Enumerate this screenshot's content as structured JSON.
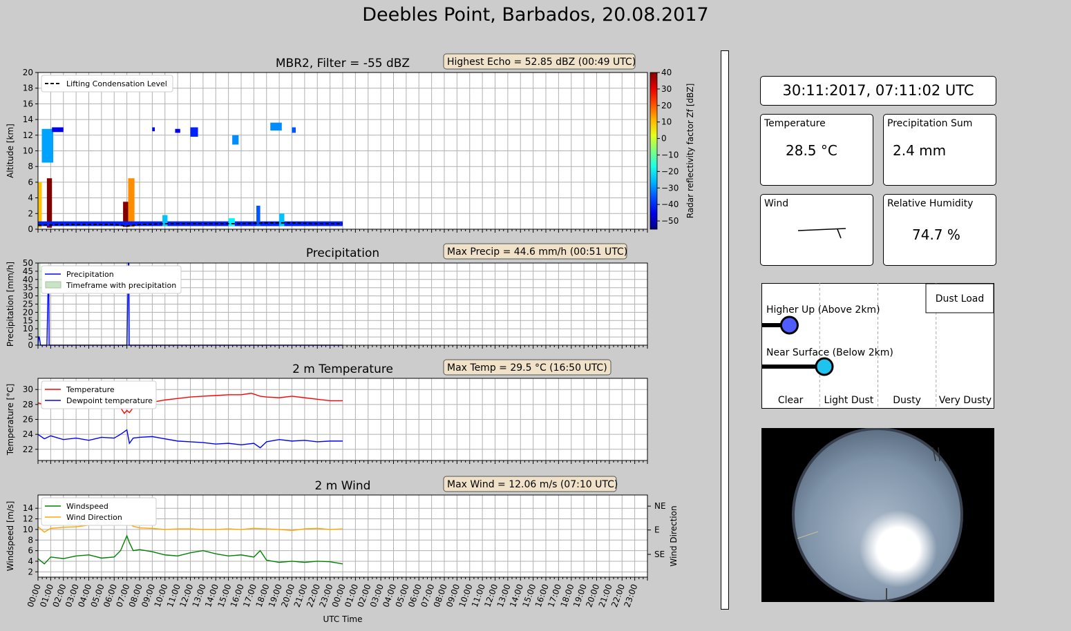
{
  "page": {
    "title": "Deebles Point, Barbados, 20.08.2017"
  },
  "colors": {
    "background": "#cccccc",
    "grid": "#b0b0b0",
    "precip_line": "#0000ff",
    "precip_band": "#c8e3c8",
    "temp_line": "#ff0000",
    "dewpoint_line": "#0000ff",
    "windspeed_line": "#008000",
    "winddir_line": "#ffa500",
    "lcl_line": "#000000",
    "dust_upper": "#4f5cff",
    "dust_lower": "#1ec3f0",
    "annotation_bg": "#f0e2c8"
  },
  "time_axis": {
    "label": "UTC Time",
    "ticks": [
      "00:00",
      "01:00",
      "02:00",
      "03:00",
      "04:00",
      "05:00",
      "06:00",
      "07:00",
      "08:00",
      "09:00",
      "10:00",
      "11:00",
      "12:00",
      "13:00",
      "14:00",
      "15:00",
      "16:00",
      "17:00",
      "18:00",
      "19:00",
      "20:00",
      "21:00",
      "22:00",
      "23:00",
      "00:00",
      "01:00",
      "02:00",
      "03:00",
      "04:00",
      "05:00",
      "06:00",
      "07:00",
      "08:00",
      "09:00",
      "10:00",
      "11:00",
      "12:00",
      "13:00",
      "14:00",
      "15:00",
      "16:00",
      "17:00",
      "18:00",
      "19:00",
      "20:00",
      "21:00",
      "22:00",
      "23:00"
    ],
    "range_hours": [
      0,
      48
    ],
    "data_until_hours": 24
  },
  "chart_data": [
    {
      "type": "heatmap",
      "title": "MBR2, Filter = -55 dBZ",
      "annotation": "Highest Echo = 52.85 dBZ (00:49 UTC)",
      "ylabel": "Altitude [km]",
      "ylim": [
        0,
        20
      ],
      "yticks": [
        0,
        2,
        4,
        6,
        8,
        10,
        12,
        14,
        16,
        18,
        20
      ],
      "grid": true,
      "legend": {
        "position": "top-left",
        "entries": [
          "Lifting Condensation Level"
        ]
      },
      "colorbar": {
        "label": "Radar reflectivity factor Zf [dBZ]",
        "range": [
          -55,
          40
        ],
        "ticks": [
          40,
          30,
          20,
          10,
          0,
          -10,
          -20,
          -30,
          -40,
          -50
        ],
        "tick_labels": [
          "40",
          "30",
          "20",
          "10",
          "0",
          "−10",
          "−20",
          "−30",
          "−40",
          "−50"
        ]
      },
      "lcl_km": {
        "x": [
          0,
          2,
          4,
          6,
          7,
          8,
          10,
          12,
          14,
          16,
          18,
          20,
          22,
          24
        ],
        "y": [
          0.5,
          0.6,
          0.6,
          0.6,
          0.4,
          0.6,
          0.7,
          0.7,
          0.7,
          0.7,
          0.8,
          0.8,
          0.7,
          0.7
        ]
      },
      "echoes": [
        {
          "x0": 0.0,
          "x1": 0.3,
          "y0": 0.2,
          "y1": 6.0,
          "dbz": 10
        },
        {
          "x0": 0.3,
          "x1": 1.2,
          "y0": 8.5,
          "y1": 12.8,
          "dbz": -28
        },
        {
          "x0": 0.7,
          "x1": 1.1,
          "y0": 0.2,
          "y1": 6.5,
          "dbz": 40
        },
        {
          "x0": 1.1,
          "x1": 2.0,
          "y0": 12.4,
          "y1": 13.0,
          "dbz": -45
        },
        {
          "x0": 6.7,
          "x1": 7.2,
          "y0": 0.3,
          "y1": 3.5,
          "dbz": 40
        },
        {
          "x0": 7.1,
          "x1": 7.6,
          "y0": 0.3,
          "y1": 6.5,
          "dbz": 15
        },
        {
          "x0": 9.0,
          "x1": 9.2,
          "y0": 12.5,
          "y1": 13.0,
          "dbz": -45
        },
        {
          "x0": 10.8,
          "x1": 11.2,
          "y0": 12.3,
          "y1": 12.8,
          "dbz": -45
        },
        {
          "x0": 12.0,
          "x1": 12.6,
          "y0": 11.8,
          "y1": 13.0,
          "dbz": -40
        },
        {
          "x0": 15.3,
          "x1": 15.8,
          "y0": 10.8,
          "y1": 12.0,
          "dbz": -30
        },
        {
          "x0": 18.3,
          "x1": 19.2,
          "y0": 12.6,
          "y1": 13.6,
          "dbz": -30
        },
        {
          "x0": 20.0,
          "x1": 20.3,
          "y0": 12.3,
          "y1": 13.0,
          "dbz": -35
        },
        {
          "x0": 0.0,
          "x1": 24.0,
          "y0": 0.4,
          "y1": 1.0,
          "dbz": -40
        },
        {
          "x0": 9.8,
          "x1": 10.2,
          "y0": 0.4,
          "y1": 1.8,
          "dbz": -25
        },
        {
          "x0": 15.0,
          "x1": 15.5,
          "y0": 0.4,
          "y1": 1.4,
          "dbz": -20
        },
        {
          "x0": 17.2,
          "x1": 17.5,
          "y0": 0.4,
          "y1": 3.0,
          "dbz": -35
        },
        {
          "x0": 19.0,
          "x1": 19.4,
          "y0": 0.4,
          "y1": 2.0,
          "dbz": -25
        }
      ]
    },
    {
      "type": "line",
      "title": "Precipitation",
      "annotation": "Max Precip = 44.6 mm/h (00:51 UTC)",
      "ylabel": "Precipitation [mm/h]",
      "ylim": [
        0,
        50
      ],
      "yticks": [
        0,
        5,
        10,
        15,
        20,
        25,
        30,
        35,
        40,
        45,
        50
      ],
      "grid": true,
      "legend": {
        "position": "top-left",
        "entries": [
          "Precipitation",
          "Timeframe with precipitation"
        ]
      },
      "series": [
        {
          "name": "Precipitation",
          "x": [
            0,
            0.05,
            0.1,
            0.2,
            0.7,
            0.82,
            0.85,
            0.88,
            1.0,
            7.0,
            7.12,
            7.15,
            7.18,
            7.3,
            24
          ],
          "y": [
            0,
            5,
            5,
            0,
            0,
            44.6,
            44.6,
            0,
            0,
            0,
            50,
            50,
            0,
            0,
            0
          ]
        }
      ],
      "precip_windows": [
        [
          0.0,
          0.2
        ],
        [
          0.8,
          0.9
        ],
        [
          7.05,
          7.25
        ]
      ]
    },
    {
      "type": "line",
      "title": "2 m Temperature",
      "annotation": "Max Temp = 29.5 °C (16:50 UTC)",
      "ylabel": "Temperature [°C]",
      "ylim": [
        20.5,
        31.5
      ],
      "yticks": [
        22,
        24,
        26,
        28,
        30
      ],
      "grid": true,
      "legend": {
        "position": "top-left",
        "entries": [
          "Temperature",
          "Dewpoint temperature"
        ]
      },
      "series": [
        {
          "name": "Temperature",
          "x": [
            0,
            0.5,
            1,
            2,
            3,
            4,
            5,
            6,
            6.5,
            6.8,
            7.0,
            7.2,
            7.5,
            8,
            9,
            10,
            11,
            12,
            13,
            14,
            15,
            16,
            16.8,
            17.5,
            18,
            19,
            20,
            21,
            22,
            23,
            24
          ],
          "y": [
            28.2,
            28.0,
            28.3,
            28.1,
            28.4,
            28.2,
            28.4,
            28.1,
            27.6,
            26.8,
            27.2,
            26.9,
            27.6,
            28.1,
            28.3,
            28.6,
            28.8,
            29.0,
            29.1,
            29.2,
            29.3,
            29.3,
            29.5,
            29.1,
            29.0,
            28.9,
            29.1,
            28.9,
            28.7,
            28.5,
            28.5
          ]
        },
        {
          "name": "Dewpoint temperature",
          "x": [
            0,
            0.5,
            1,
            2,
            3,
            4,
            5,
            6,
            6.5,
            7.0,
            7.2,
            7.5,
            8,
            9,
            10,
            11,
            12,
            13,
            14,
            15,
            16,
            17,
            17.5,
            18,
            19,
            20,
            21,
            22,
            23,
            24
          ],
          "y": [
            24.0,
            23.4,
            23.8,
            23.3,
            23.5,
            23.2,
            23.6,
            23.5,
            24.0,
            24.6,
            22.8,
            23.5,
            23.6,
            23.7,
            23.4,
            23.1,
            23.0,
            22.9,
            22.7,
            22.8,
            22.6,
            22.8,
            22.2,
            23.0,
            23.3,
            23.1,
            23.2,
            23.0,
            23.1,
            23.1
          ]
        }
      ]
    },
    {
      "type": "line",
      "title": "2 m Wind",
      "annotation": "Max Wind = 12.06 m/s (07:10 UTC)",
      "ylabel": "Windspeed [m/s]",
      "ylim": [
        1,
        16.5
      ],
      "yticks": [
        2,
        4,
        6,
        8,
        10,
        12,
        14
      ],
      "y2label": "Wind Direction",
      "y2ticks": [
        {
          "label": "NE",
          "value": 14.4
        },
        {
          "label": "E",
          "value": 9.9
        },
        {
          "label": "SE",
          "value": 5.3
        }
      ],
      "grid": true,
      "legend": {
        "position": "top-left",
        "entries": [
          "Windspeed",
          "Wind Direction"
        ]
      },
      "series": [
        {
          "name": "Windspeed",
          "x": [
            0,
            0.5,
            1,
            2,
            3,
            4,
            5,
            6,
            6.5,
            7.0,
            7.2,
            7.5,
            8,
            9,
            10,
            11,
            12,
            13,
            14,
            15,
            16,
            17,
            17.5,
            18,
            19,
            20,
            21,
            22,
            23,
            24
          ],
          "y": [
            4.5,
            3.5,
            4.8,
            4.5,
            5.0,
            5.2,
            4.6,
            4.8,
            6.0,
            8.8,
            7.5,
            6.0,
            6.2,
            5.8,
            5.2,
            5.0,
            5.6,
            6.0,
            5.4,
            5.0,
            5.2,
            4.8,
            6.0,
            4.2,
            3.8,
            4.0,
            3.8,
            4.0,
            3.9,
            3.5
          ]
        },
        {
          "name": "Wind Direction",
          "x": [
            0,
            0.5,
            1,
            2,
            3,
            4,
            5,
            6,
            6.5,
            7.0,
            7.2,
            7.5,
            8,
            9,
            10,
            11,
            12,
            13,
            14,
            15,
            16,
            17,
            18,
            19,
            20,
            21,
            22,
            23,
            24
          ],
          "y": [
            10.5,
            9.5,
            10.2,
            10.4,
            10.5,
            10.8,
            10.9,
            11.0,
            11.3,
            11.5,
            11.0,
            10.6,
            10.3,
            10.2,
            10.0,
            10.1,
            10.1,
            10.0,
            10.0,
            10.1,
            10.0,
            10.2,
            10.1,
            10.0,
            9.8,
            10.1,
            10.2,
            10.0,
            10.1
          ]
        }
      ]
    }
  ],
  "sidebar": {
    "datetime": "30:11:2017, 07:11:02 UTC",
    "temperature": {
      "label": "Temperature",
      "value": "28.5 °C"
    },
    "precip_sum": {
      "label": "Precipitation Sum",
      "value": "2.4 mm"
    },
    "wind": {
      "label": "Wind"
    },
    "humidity": {
      "label": "Relative Humidity",
      "value": "74.7 %"
    },
    "dust": {
      "title": "Dust Load",
      "upper_label": "Higher Up (Above 2km)",
      "lower_label": "Near Surface (Below 2km)",
      "categories": [
        "Clear",
        "Light Dust",
        "Dusty",
        "Very Dusty"
      ],
      "upper_level": 0.12,
      "lower_level": 0.27
    }
  }
}
